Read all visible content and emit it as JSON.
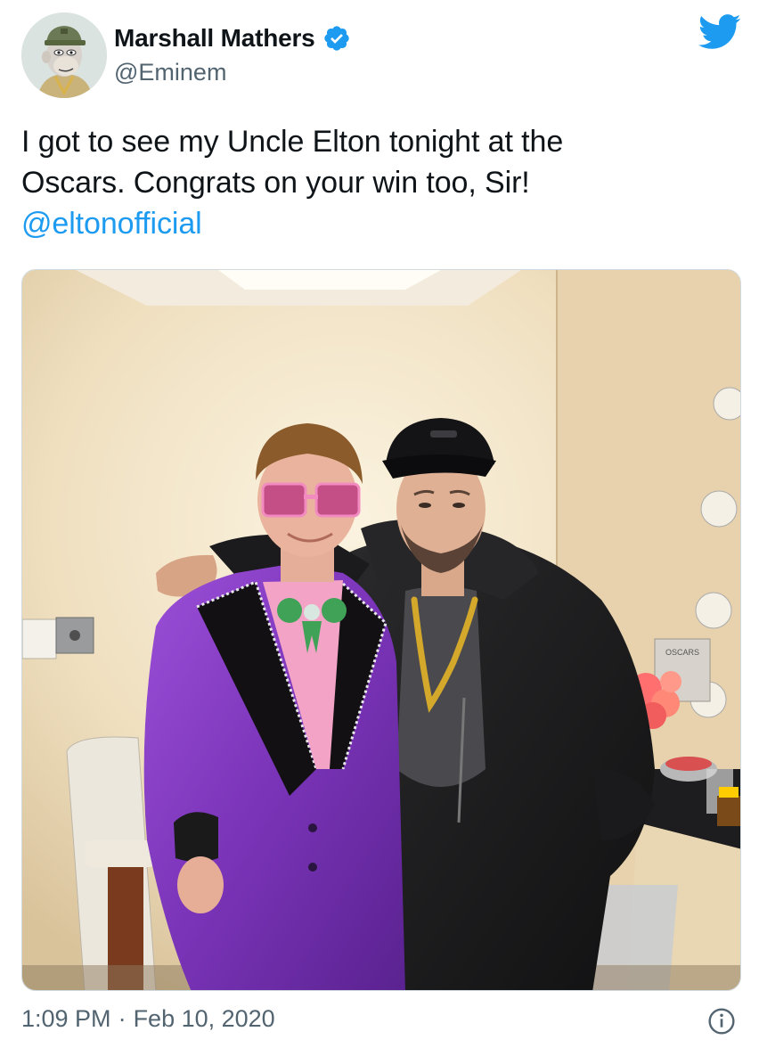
{
  "author": {
    "display_name": "Marshall Mathers",
    "handle": "@Eminem",
    "verified_icon": "verified-badge-icon",
    "avatar_icon": "bored-ape-avatar"
  },
  "brand": {
    "logo_icon": "twitter-bird-icon",
    "accent_color": "#1d9bf0"
  },
  "tweet": {
    "line1": "I got to see my Uncle Elton tonight at the",
    "line2": "Oscars.  Congrats on your win too, Sir!",
    "mention": "@eltonofficial"
  },
  "photo": {
    "sign_text": "OSCARS"
  },
  "footer": {
    "time": "1:09 PM",
    "separator": "·",
    "date": "Feb 10, 2020",
    "info_icon": "info-icon"
  }
}
